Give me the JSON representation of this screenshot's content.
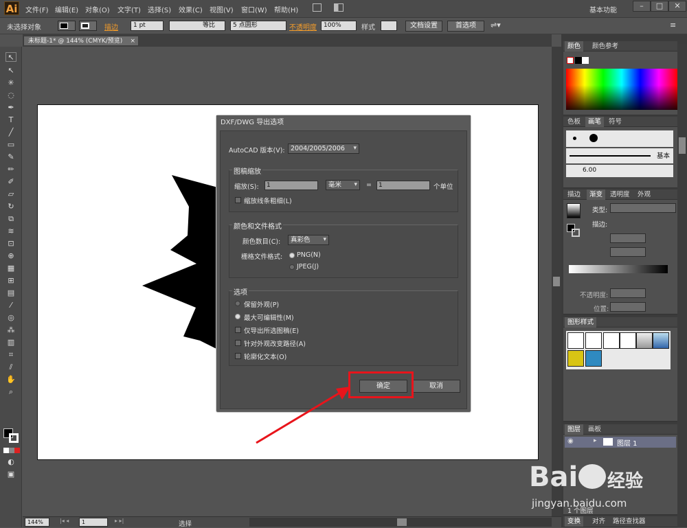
{
  "app": {
    "logo": "Ai",
    "menus": [
      "文件(F)",
      "编辑(E)",
      "对象(O)",
      "文字(T)",
      "选择(S)",
      "效果(C)",
      "视图(V)",
      "窗口(W)",
      "帮助(H)"
    ],
    "workspace": "基本功能"
  },
  "control_bar": {
    "selection": "未选择对象",
    "stroke_label": "描边",
    "stroke_weight": "1 pt",
    "profile": "等比",
    "brush": "5 点圆形",
    "opacity_label": "不透明度",
    "opacity_value": "100%",
    "style_label": "样式",
    "doc_setup": "文档设置",
    "preferences": "首选项"
  },
  "document_tab": {
    "title": "未标题-1* @ 144% (CMYK/预览)"
  },
  "dialog": {
    "title": "DXF/DWG 导出选项",
    "version_label": "AutoCAD 版本(V):",
    "version_value": "2004/2005/2006",
    "scale_group": "图稿缩放",
    "scale_label": "缩放(S):",
    "scale_value": "1",
    "unit": "毫米",
    "equals": "=",
    "unit_value": "1",
    "unit_suffix": "个单位",
    "scale_lineweight": "缩放线条粗细(L)",
    "color_group": "颜色和文件格式",
    "color_count_label": "颜色数目(C):",
    "color_count_value": "真彩色",
    "raster_label": "栅格文件格式:",
    "raster_png": "PNG(N)",
    "raster_jpeg": "JPEG(J)",
    "options_group": "选项",
    "opt_preserve": "保留外观(P)",
    "opt_editability": "最大可编辑性(M)",
    "opt_export_selected": "仅导出所选图稿(E)",
    "opt_alter_paths": "针对外观改变路径(A)",
    "opt_outline_text": "轮廓化文本(O)",
    "ok": "确定",
    "cancel": "取消"
  },
  "panels": {
    "color_tabs": [
      "颜色",
      "颜色参考"
    ],
    "brush_tabs": [
      "色板",
      "画笔",
      "符号"
    ],
    "brush_line_label": "基本",
    "brush_size": "6.00",
    "stroke_tabs": [
      "描边",
      "渐变",
      "透明度",
      "外观"
    ],
    "gradient_type": "类型:",
    "gradient_stroke": "描边:",
    "gradient_opacity": "不透明度:",
    "gradient_location": "位置:",
    "graphic_styles_tab": "图形样式",
    "layers_tabs": [
      "图层",
      "画板"
    ],
    "layer_name": "图层 1",
    "layer_count": "1 个图层",
    "bottom_tabs": [
      "变换",
      "对齐",
      "路径查找器"
    ]
  },
  "status_bar": {
    "zoom": "144%",
    "artboard": "1",
    "tool": "选择"
  },
  "colors": {
    "highlight_box": "#e8141b",
    "arrow": "#e8141b",
    "orange_label": "#f39c2a"
  },
  "watermark": {
    "brand": "Bai",
    "brand2": "经验",
    "url": "jingyan.baidu.com"
  }
}
